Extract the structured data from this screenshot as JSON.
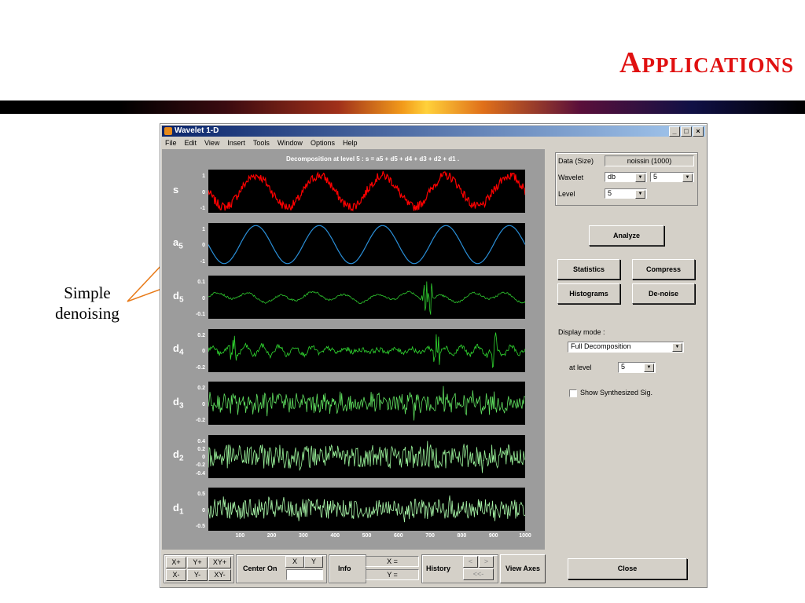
{
  "slide": {
    "title": "Applications",
    "annotation": "Simple denoising",
    "annotation_line1": "Simple",
    "annotation_line2": "denoising"
  },
  "window": {
    "title": "Wavelet 1-D",
    "menu": [
      "File",
      "Edit",
      "View",
      "Insert",
      "Tools",
      "Window",
      "Options",
      "Help"
    ],
    "controls": {
      "minimize": "_",
      "maximize": "□",
      "close": "×"
    }
  },
  "plot": {
    "header": "Decomposition at level 5 : s = a5 + d5 + d4 + d3 + d2 + d1 .",
    "x_ticks": [
      "100",
      "200",
      "300",
      "400",
      "500",
      "600",
      "700",
      "800",
      "900",
      "1000"
    ],
    "rows": [
      {
        "name": "s",
        "sub": "",
        "color": "#ff0000",
        "ticks": [
          "1",
          "0",
          "-1"
        ]
      },
      {
        "name": "a",
        "sub": "5",
        "color": "#2a8fd8",
        "ticks": [
          "1",
          "0",
          "-1"
        ]
      },
      {
        "name": "d",
        "sub": "5",
        "color": "#2ec82e",
        "ticks": [
          "0.1",
          "0",
          "-0.1"
        ]
      },
      {
        "name": "d",
        "sub": "4",
        "color": "#30d830",
        "ticks": [
          "0.2",
          "0",
          "-0.2"
        ]
      },
      {
        "name": "d",
        "sub": "3",
        "color": "#60e060",
        "ticks": [
          "0.2",
          "0",
          "-0.2"
        ]
      },
      {
        "name": "d",
        "sub": "2",
        "color": "#9af29a",
        "ticks": [
          "0.4",
          "0.2",
          "0",
          "-0.2",
          "-0.4"
        ]
      },
      {
        "name": "d",
        "sub": "1",
        "color": "#a8f5a8",
        "ticks": [
          "0.5",
          "0",
          "-0.5"
        ]
      }
    ]
  },
  "data_panel": {
    "data_label": "Data  (Size)",
    "data_value": "noissin  (1000)",
    "wavelet_label": "Wavelet",
    "wavelet_family": "db",
    "wavelet_order": "5",
    "level_label": "Level",
    "level_value": "5"
  },
  "buttons": {
    "analyze": "Analyze",
    "statistics": "Statistics",
    "compress": "Compress",
    "histograms": "Histograms",
    "denoise": "De-noise",
    "close": "Close"
  },
  "display": {
    "mode_label": "Display mode :",
    "mode_value": "Full Decomposition",
    "at_level_label": "at level",
    "at_level_value": "5",
    "show_synth_label": "Show Synthesized Sig."
  },
  "toolbar": {
    "x_plus": "X+",
    "y_plus": "Y+",
    "xy_plus": "XY+",
    "x_minus": "X-",
    "y_minus": "Y-",
    "xy_minus": "XY-",
    "center_on": "Center On",
    "center_x": "X",
    "center_y": "Y",
    "info": "Info",
    "x_eq": "X =",
    "y_eq": "Y =",
    "history": "History",
    "hist_back": "<",
    "hist_fwd": ">",
    "hist_first": "<<-",
    "view_axes": "View Axes"
  }
}
